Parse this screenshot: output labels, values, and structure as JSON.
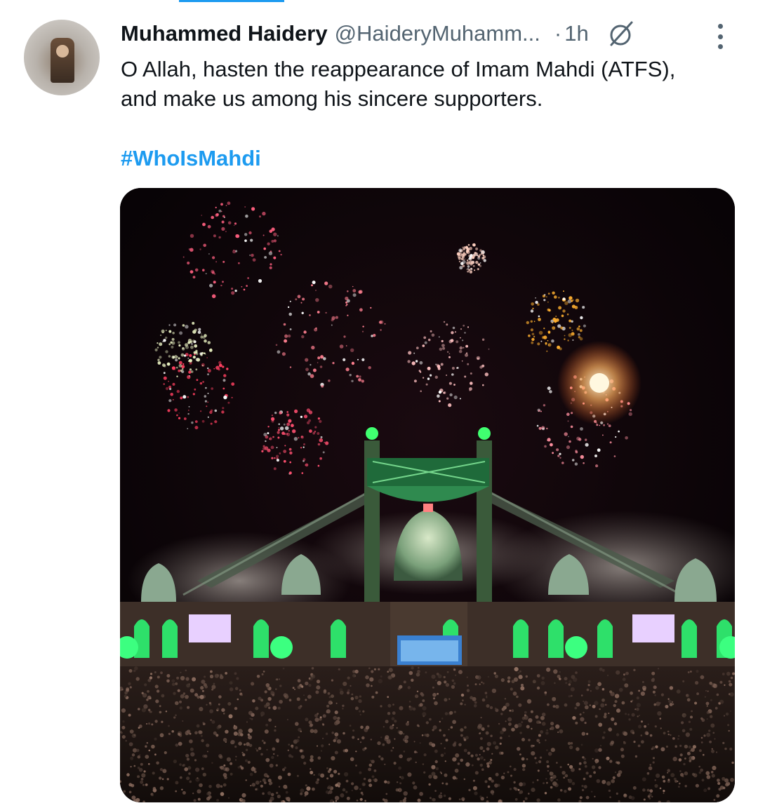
{
  "tweet": {
    "author_name": "Muhammed Haidery",
    "author_handle": "@HaideryMuhamm...",
    "separator": "·",
    "time": "1h",
    "text_line1": "O Allah, hasten the reappearance of Imam Mahdi (ATFS),",
    "text_line2": "and make us among his sincere supporters.",
    "hashtag": "#WhoIsMahdi"
  },
  "icons": {
    "grok": "grok-icon",
    "more": "more-options-icon"
  },
  "colors": {
    "link": "#1d9bf0",
    "secondary_text": "#536471",
    "primary_text": "#0f1419"
  }
}
